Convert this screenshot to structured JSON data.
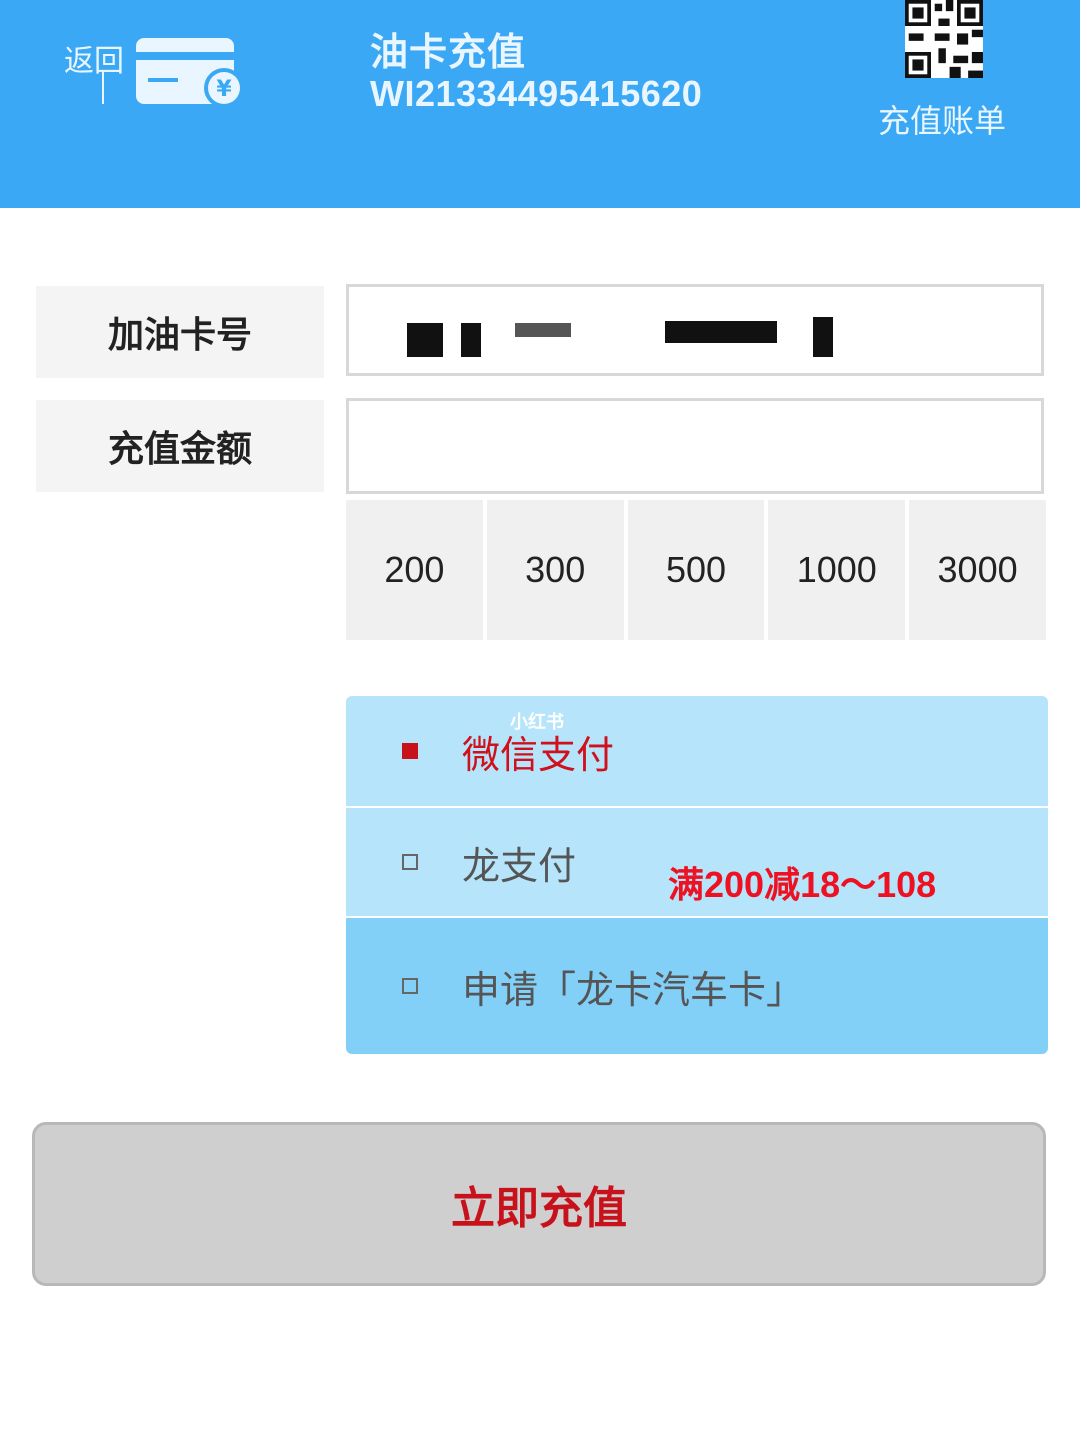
{
  "header": {
    "back_label": "返回",
    "title": "油卡充值",
    "card_id": "WI21334495415620",
    "bill_label": "充值账单",
    "card_icon": "card-yuan-icon",
    "qr_icon": "qr-code-icon"
  },
  "form": {
    "card_number_label": "加油卡号",
    "card_number_value": "",
    "amount_label": "充值金额",
    "amount_value": ""
  },
  "amount_options": [
    "200",
    "300",
    "500",
    "1000",
    "3000"
  ],
  "payment": {
    "watermark": "小红书",
    "options": [
      {
        "label": "微信支付",
        "selected": true
      },
      {
        "label": "龙支付",
        "selected": false
      },
      {
        "label": "申请「龙卡汽车卡」",
        "selected": false
      }
    ],
    "promo": "满200减18～108"
  },
  "submit_label": "立即充值",
  "colors": {
    "header_bg": "#3aa8f5",
    "accent_red": "#c8121b",
    "pay_bg": "#b5e4fb",
    "pay_bg_dark": "#82cff8"
  }
}
